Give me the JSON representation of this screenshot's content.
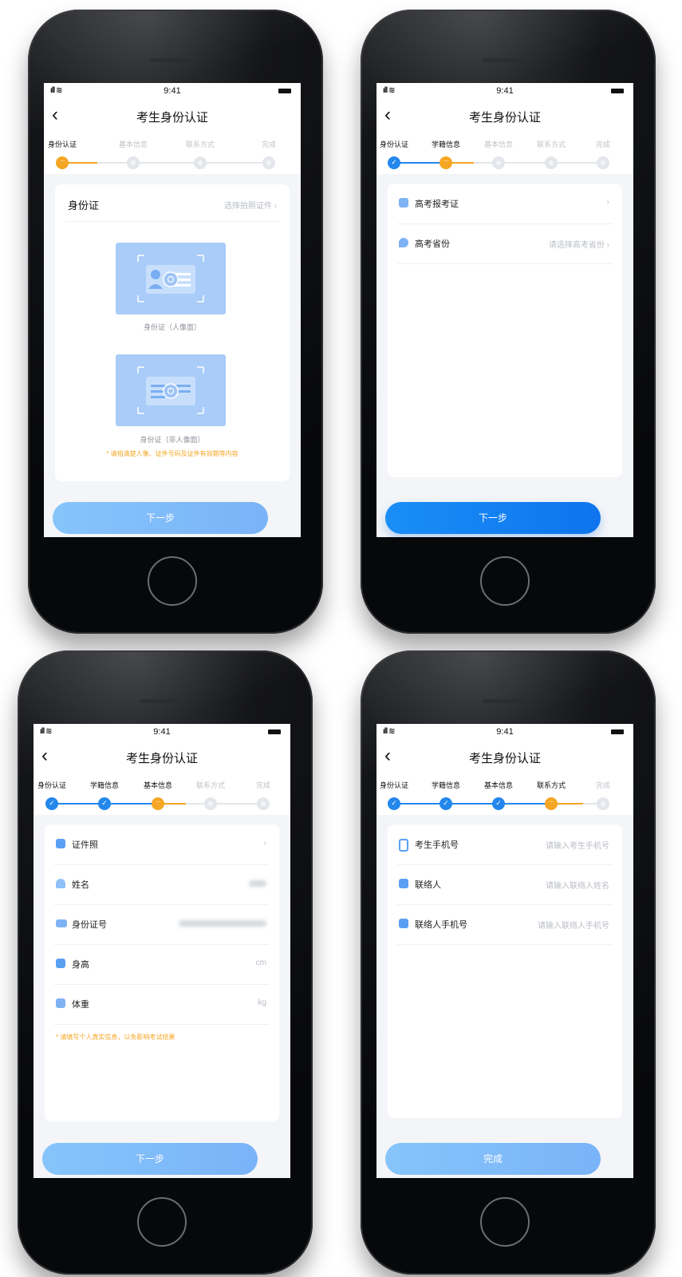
{
  "status": {
    "time": "9:41"
  },
  "nav": {
    "back": "‹",
    "title": "考生身份认证"
  },
  "steps_all": [
    "身份认证",
    "学籍信息",
    "基本信息",
    "联系方式",
    "完成"
  ],
  "screen1": {
    "steps": [
      "身份认证",
      "基本信息",
      "联系方式",
      "完成"
    ],
    "card_title": "身份证",
    "card_hint": "选择拍照证件 ›",
    "front_caption": "身份证（人像面）",
    "back_caption": "身份证（非人像面）",
    "warning": "* 请拍清楚人像、证件号码及证件有效期等内容",
    "button": "下一步"
  },
  "screen2": {
    "rows": [
      {
        "label": "高考报考证",
        "value": "›",
        "icon": "id-card-icon"
      },
      {
        "label": "高考省份",
        "value": "请选择高考省份 ›",
        "icon": "location-icon"
      }
    ],
    "button": "下一步"
  },
  "screen3": {
    "rows": [
      {
        "label": "证件照",
        "value": "›"
      },
      {
        "label": "姓名",
        "value": ""
      },
      {
        "label": "身份证号",
        "value": ""
      },
      {
        "label": "身高",
        "value": "cm"
      },
      {
        "label": "体重",
        "value": "kg"
      }
    ],
    "warning": "* 请填写个人真实信息，以免影响考试结果",
    "button": "下一步"
  },
  "screen4": {
    "rows": [
      {
        "label": "考生手机号",
        "value": "请输入考生手机号"
      },
      {
        "label": "联络人",
        "value": "请输入联络人姓名"
      },
      {
        "label": "联络人手机号",
        "value": "请输入联络人手机号"
      }
    ],
    "button": "完成"
  },
  "colors": {
    "primary": "#2387ec",
    "current": "#f5a623",
    "pending": "#e3e6ea",
    "button_light": "#86c4fb"
  }
}
